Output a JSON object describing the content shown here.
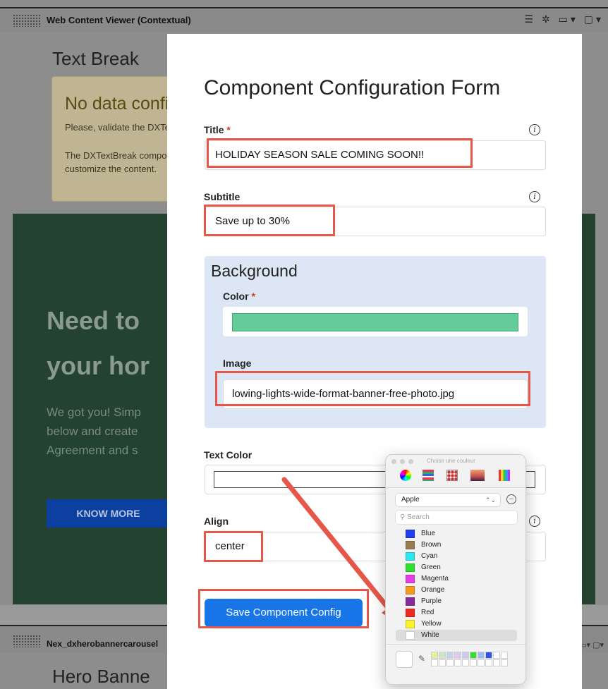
{
  "portlet": {
    "title": "Web Content Viewer (Contextual)",
    "tools": "☰ ✲ ▭▾ ▢▾"
  },
  "background_page": {
    "textbreak_heading": "Text Break",
    "warning": {
      "title": "No data configured",
      "line1": "Please, validate the DXTextBreak configuration.",
      "line2": "The DXTextBreak component allows you to customize the content."
    },
    "hero": {
      "heading_line1": "Need to",
      "heading_line2": "your hor",
      "paragraph_line1": "We got you! Simp",
      "paragraph_line2": "below and create",
      "paragraph_line3": "Agreement and s",
      "button_label": "KNOW MORE"
    },
    "portlet2_title": "Nex_dxherobannercarousel",
    "portlet2_tools": "▭▾ ▢▾",
    "hero_banner_heading": "Hero Banne"
  },
  "modal": {
    "title": "Component Configuration Form",
    "fields": {
      "title_label": "Title",
      "title_value": "HOLIDAY SEASON SALE COMING SOON!!",
      "subtitle_label": "Subtitle",
      "subtitle_value": "Save up to 30%",
      "background_heading": "Background",
      "color_label": "Color",
      "color_value": "#63cc9a",
      "image_label": "Image",
      "image_value": "lowing-lights-wide-format-banner-free-photo.jpg",
      "text_color_label": "Text Color",
      "align_label": "Align",
      "align_value": "center"
    },
    "required_mark": "*",
    "info_glyph": "i",
    "save_button_label": "Save Component Config"
  },
  "color_picker": {
    "window_title": "Choisir une couleur",
    "palette_select": "Apple",
    "search_placeholder": "Search",
    "colors": [
      {
        "name": "Blue",
        "hex": "#1f3ff0"
      },
      {
        "name": "Brown",
        "hex": "#9a7b52"
      },
      {
        "name": "Cyan",
        "hex": "#2ee6f0"
      },
      {
        "name": "Green",
        "hex": "#2fe02f"
      },
      {
        "name": "Magenta",
        "hex": "#e83ee8"
      },
      {
        "name": "Orange",
        "hex": "#f59a1c"
      },
      {
        "name": "Purple",
        "hex": "#8a2a9a"
      },
      {
        "name": "Red",
        "hex": "#f02a1f"
      },
      {
        "name": "Yellow",
        "hex": "#fbf22a"
      },
      {
        "name": "White",
        "hex": "#ffffff"
      }
    ],
    "selected_color": "White"
  },
  "colors": {
    "accent_blue": "#1775e8",
    "annotation_red": "#e6574a",
    "background_section": "#dde6f4",
    "hero_green": "#23422f"
  }
}
